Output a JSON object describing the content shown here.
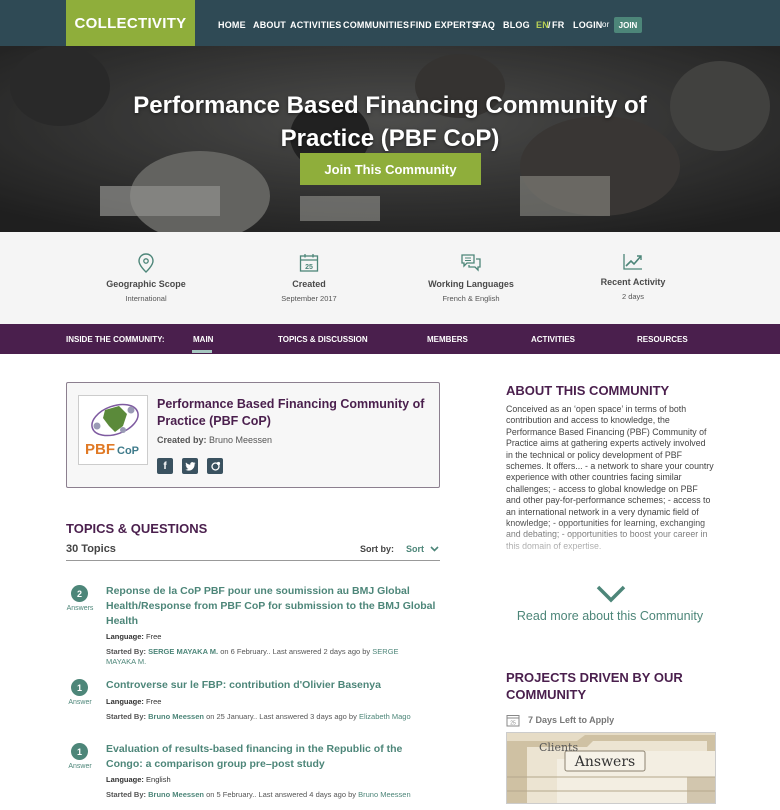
{
  "header": {
    "logo": "COLLECTIVITY",
    "nav": [
      "HOME",
      "ABOUT",
      "ACTIVITIES",
      "COMMUNITIES",
      "FIND EXPERTS",
      "FAQ",
      "BLOG"
    ],
    "lang_en": "EN",
    "lang_sep": "/",
    "lang_fr": "FR",
    "login": "LOGIN",
    "or": "or",
    "join": "JOIN"
  },
  "hero": {
    "title": "Performance Based Financing Community of Practice (PBF CoP)",
    "button": "Join This Community"
  },
  "stats": [
    {
      "title": "Geographic Scope",
      "value": "International",
      "icon": "map-pin-icon"
    },
    {
      "title": "Created",
      "value": "September 2017",
      "icon": "calendar-icon",
      "icon_text": "25"
    },
    {
      "title": "Working Languages",
      "value": "French & English",
      "icon": "chat-icon"
    },
    {
      "title": "Recent Activity",
      "value": "2 days",
      "icon": "trend-chart-icon"
    }
  ],
  "subnav": {
    "label": "INSIDE THE COMMUNITY:",
    "items": [
      "MAIN",
      "TOPICS & DISCUSSION",
      "MEMBERS",
      "ACTIVITIES",
      "RESOURCES"
    ],
    "active": "MAIN"
  },
  "card": {
    "title": "Performance Based Financing Community of Practice (PBF CoP)",
    "created_label": "Created by:",
    "created_by": "Bruno Meessen",
    "logo_text": "PBF",
    "logo_text2": "CoP",
    "social": [
      "facebook-icon",
      "twitter-icon",
      "share-icon"
    ]
  },
  "topics": {
    "title": "TOPICS & QUESTIONS",
    "count": "30 Topics",
    "sort_by": "Sort by:",
    "sort_value": "Sort",
    "items": [
      {
        "badge": "2",
        "badge_label": "Answers",
        "title": "Reponse de la CoP PBF pour une soumission au BMJ Global Health/Response from PBF CoP for submission to the BMJ Global Health",
        "lang_label": "Language:",
        "lang": "Free",
        "started_label": "Started By:",
        "started_by": "SERGE MAYAKA M.",
        "meta_mid": "on 6 February.. Last answered 2 days ago by",
        "last_by": "SERGE MAYAKA M."
      },
      {
        "badge": "1",
        "badge_label": "Answer",
        "title": "Controverse sur le FBP: contribution d'Olivier Basenya",
        "lang_label": "Language:",
        "lang": "Free",
        "started_label": "Started By:",
        "started_by": "Bruno Meessen",
        "meta_mid": "on 25 January.. Last answered 3 days ago by",
        "last_by": "Elizabeth Mago"
      },
      {
        "badge": "1",
        "badge_label": "Answer",
        "title": "Evaluation of results-based financing in the Republic of the Congo: a comparison group pre–post study",
        "lang_label": "Language:",
        "lang": "English",
        "started_label": "Started By:",
        "started_by": "Bruno Meessen",
        "meta_mid": "on 5 February.. Last answered 4 days ago by",
        "last_by": "Bruno Meessen"
      }
    ]
  },
  "about": {
    "title": "ABOUT THIS COMMUNITY",
    "text": "Conceived as an ‘open space’ in terms of both contribution and access to knowledge, the Performance Based Financing (PBF) Community of Practice aims at gathering experts actively involved in the technical or policy development of PBF schemes. It offers... - a network to share your country experience with other countries facing similar challenges; - access to global knowledge on PBF and other pay-for-performance schemes; - access to an international network in a very dynamic field of knowledge; - opportunities for learning, exchanging and debating; - opportunities to boost your career in this domain of expertise.",
    "read_more": "Read more about this Community"
  },
  "projects": {
    "title": "PROJECTS DRIVEN BY OUR COMMUNITY",
    "days_left": "7 Days Left to Apply",
    "calendar_text": "25",
    "image_tab1": "Clients",
    "image_tab2": "Answers"
  },
  "colors": {
    "topbar": "#2f4a55",
    "brand_green": "#8fae3b",
    "purple": "#4a1f4d",
    "teal": "#4d8679"
  }
}
